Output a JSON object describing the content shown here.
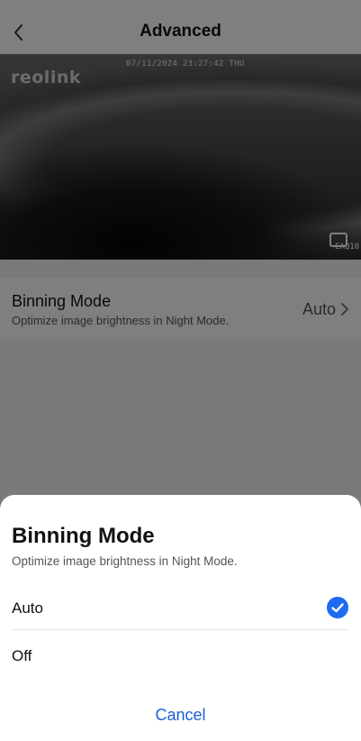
{
  "header": {
    "title": "Advanced",
    "back_icon": "chevron-left-icon"
  },
  "camera": {
    "timestamp": "07/11/2024 23:27:42 THU",
    "logo": "reolink",
    "badge_text": "EAQ10"
  },
  "settings": {
    "binning_mode": {
      "label": "Binning Mode",
      "description": "Optimize image brightness in Night Mode.",
      "value": "Auto"
    }
  },
  "sheet": {
    "title": "Binning Mode",
    "subtitle": "Optimize image brightness in Night Mode.",
    "options": [
      {
        "label": "Auto",
        "selected": true
      },
      {
        "label": "Off",
        "selected": false
      }
    ],
    "cancel_label": "Cancel"
  },
  "colors": {
    "accent": "#1d6bf3",
    "cancel_text": "#1d5fd6"
  }
}
